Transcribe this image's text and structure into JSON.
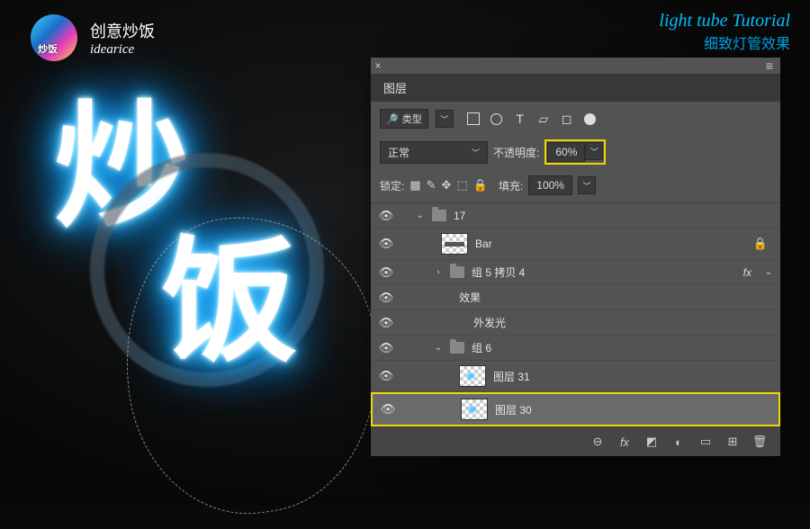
{
  "brand": {
    "cn": "创意炒饭",
    "en": "idearice"
  },
  "tutorial": {
    "en": "light tube Tutorial",
    "cn": "细致灯管效果"
  },
  "neon": {
    "char1": "炒",
    "char2": "饭"
  },
  "panel": {
    "title": "图层",
    "filter_label": "类型",
    "blend_mode": "正常",
    "opacity_label": "不透明度:",
    "opacity_value": "60%",
    "lock_label": "锁定:",
    "fill_label": "填充:",
    "fill_value": "100%"
  },
  "layers": {
    "group_top": "17",
    "bar": "Bar",
    "group5": "组 5 拷贝 4",
    "fx_label": "效果",
    "outer_glow": "外发光",
    "group6": "组 6",
    "layer31": "图层 31",
    "layer30": "图层 30",
    "fx_badge": "fx"
  }
}
